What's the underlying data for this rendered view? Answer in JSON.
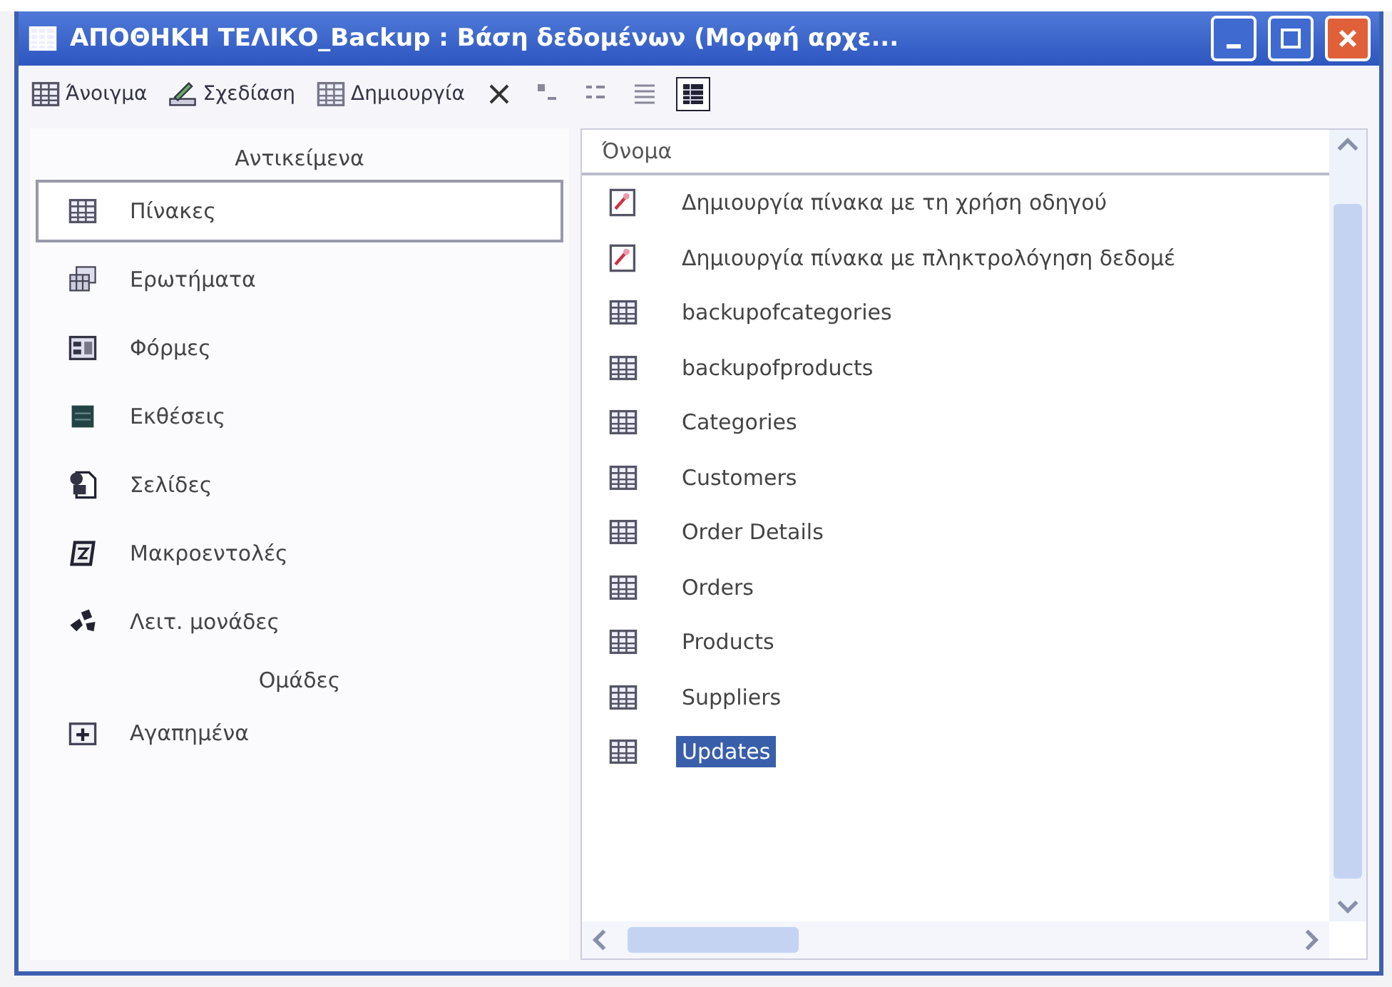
{
  "window": {
    "title": "ΑΠΟΘΗΚΗ ΤΕΛΙΚΟ_Backup : Βάση δεδομένων (Μορφή αρχε..."
  },
  "toolbar": {
    "buttons": [
      {
        "kind": "open",
        "label": "Άνοιγμα"
      },
      {
        "kind": "design",
        "label": "Σχεδίαση"
      },
      {
        "kind": "new",
        "label": "Δημιουργία"
      }
    ],
    "views": [
      {
        "kind": "delete",
        "selected": false
      },
      {
        "kind": "large-icons",
        "selected": false
      },
      {
        "kind": "small-icons",
        "selected": false
      },
      {
        "kind": "list",
        "selected": false
      },
      {
        "kind": "details",
        "selected": true
      }
    ]
  },
  "sidebar": {
    "objects_header": "Αντικείμενα",
    "items": [
      {
        "kind": "tables",
        "label": "Πίνακες",
        "selected": true
      },
      {
        "kind": "queries",
        "label": "Ερωτήματα",
        "selected": false
      },
      {
        "kind": "forms",
        "label": "Φόρμες",
        "selected": false
      },
      {
        "kind": "reports",
        "label": "Εκθέσεις",
        "selected": false
      },
      {
        "kind": "pages",
        "label": "Σελίδες",
        "selected": false
      },
      {
        "kind": "macros",
        "label": "Μακροεντολές",
        "selected": false
      },
      {
        "kind": "modules",
        "label": "Λειτ. μονάδες",
        "selected": false
      }
    ],
    "groups_header": "Ομάδες",
    "groups": [
      {
        "kind": "favorites",
        "label": "Αγαπημένα",
        "selected": false
      }
    ]
  },
  "list": {
    "columns": [
      "Όνομα"
    ],
    "rows": [
      {
        "kind": "wizard",
        "name": "Δημιουργία πίνακα με τη χρήση οδηγού",
        "selected": false
      },
      {
        "kind": "wizard",
        "name": "Δημιουργία πίνακα με πληκτρολόγηση δεδομέ",
        "selected": false
      },
      {
        "kind": "table",
        "name": "backupofcategories",
        "selected": false
      },
      {
        "kind": "table",
        "name": "backupofproducts",
        "selected": false
      },
      {
        "kind": "table",
        "name": "Categories",
        "selected": false
      },
      {
        "kind": "table",
        "name": "Customers",
        "selected": false
      },
      {
        "kind": "table",
        "name": "Order Details",
        "selected": false
      },
      {
        "kind": "table",
        "name": "Orders",
        "selected": false
      },
      {
        "kind": "table",
        "name": "Products",
        "selected": false
      },
      {
        "kind": "table",
        "name": "Suppliers",
        "selected": false
      },
      {
        "kind": "table",
        "name": "Updates",
        "selected": true
      }
    ]
  }
}
